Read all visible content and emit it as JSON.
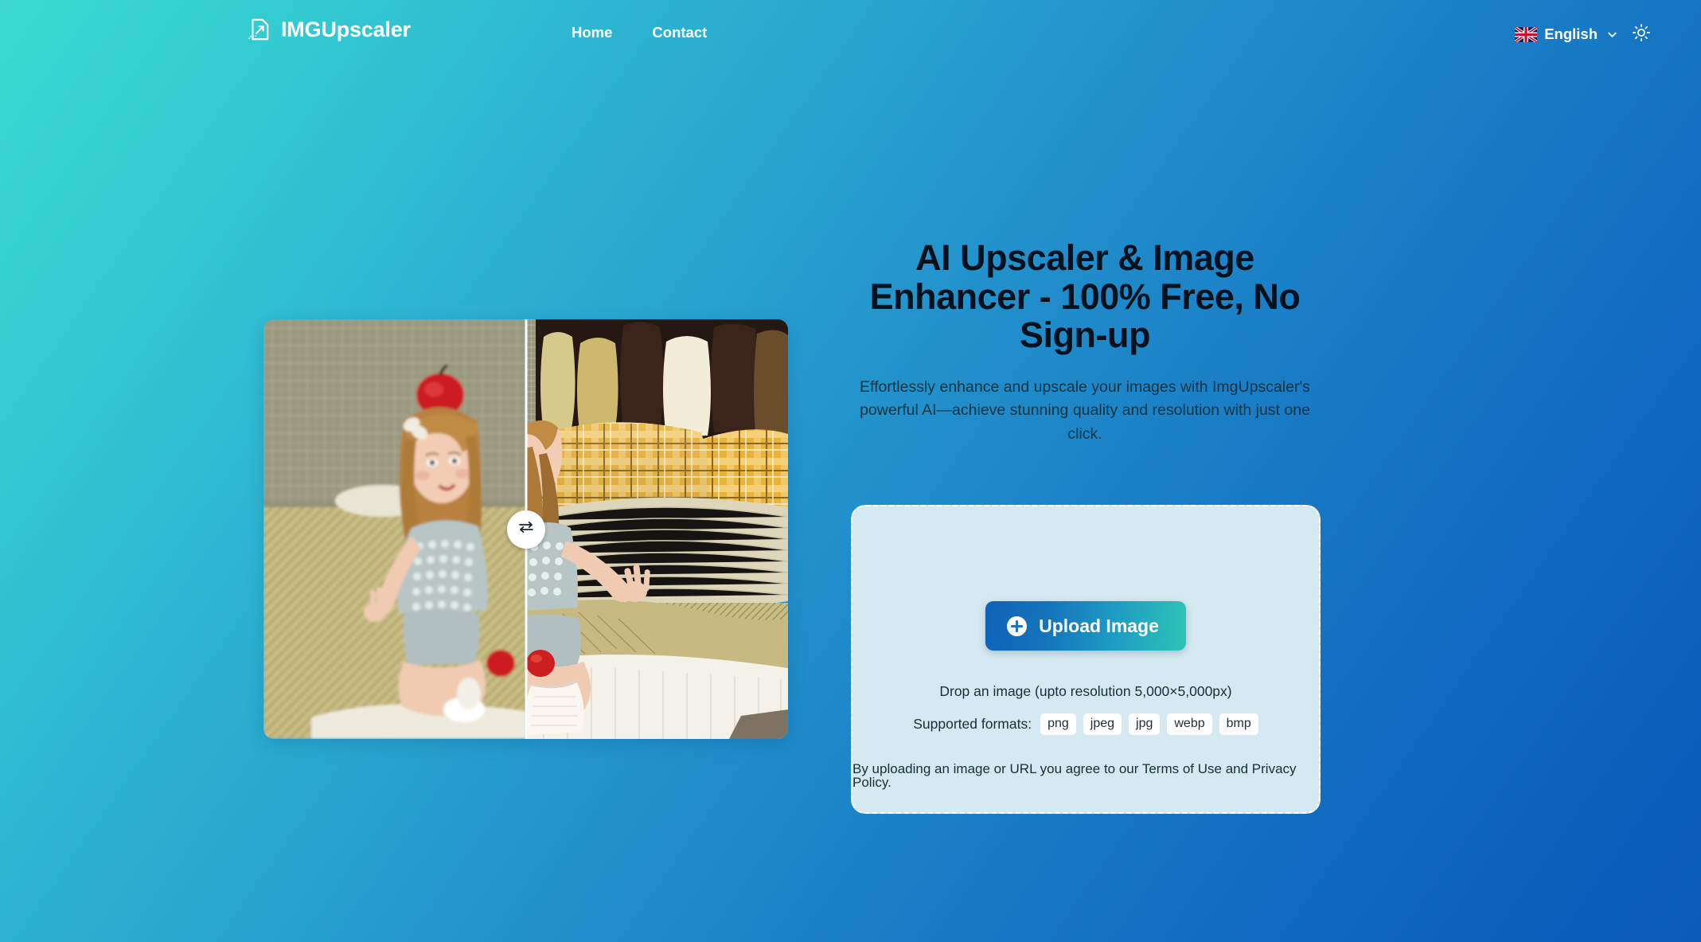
{
  "header": {
    "brand_name": "IMGUpscaler",
    "brand_icon": "image-upscale-icon",
    "nav": [
      {
        "label": "Home"
      },
      {
        "label": "Contact"
      }
    ],
    "language": {
      "label": "English",
      "flag_icon": "uk-flag-icon",
      "chevron_icon": "chevron-down-icon"
    },
    "theme_toggle_icon": "sun-icon"
  },
  "hero": {
    "title": "AI Upscaler & Image Enhancer - 100% Free, No Sign-up",
    "subtitle": "Effortlessly enhance and upscale your images with ImgUpscaler's powerful AI—achieve stunning quality and resolution with just one click.",
    "comparison": {
      "handle_icon": "swap-arrows-icon",
      "divider_position_percent": 50,
      "alt": "before-and-after-upscaled-photo-of-girl-on-bed"
    }
  },
  "upload": {
    "button_label": "Upload Image",
    "button_icon": "plus-circle-icon",
    "drop_hint": "Drop an image (upto resolution 5,000×5,000px)",
    "formats_label": "Supported formats:",
    "formats": [
      "png",
      "jpeg",
      "jpg",
      "webp",
      "bmp"
    ],
    "terms_prefix": "By uploading an image or URL you agree to our ",
    "terms_of_use": "Terms of Use",
    "terms_and": " and ",
    "privacy_policy": "Privacy Policy",
    "terms_suffix": "."
  },
  "colors": {
    "bg_gradient_start": "#3cd9d0",
    "bg_gradient_end": "#0a5abb",
    "card_bg": "#d5e9f1",
    "button_gradient_start": "#0f63b8",
    "button_gradient_end": "#2ec4b6",
    "title_color": "#05121d"
  }
}
